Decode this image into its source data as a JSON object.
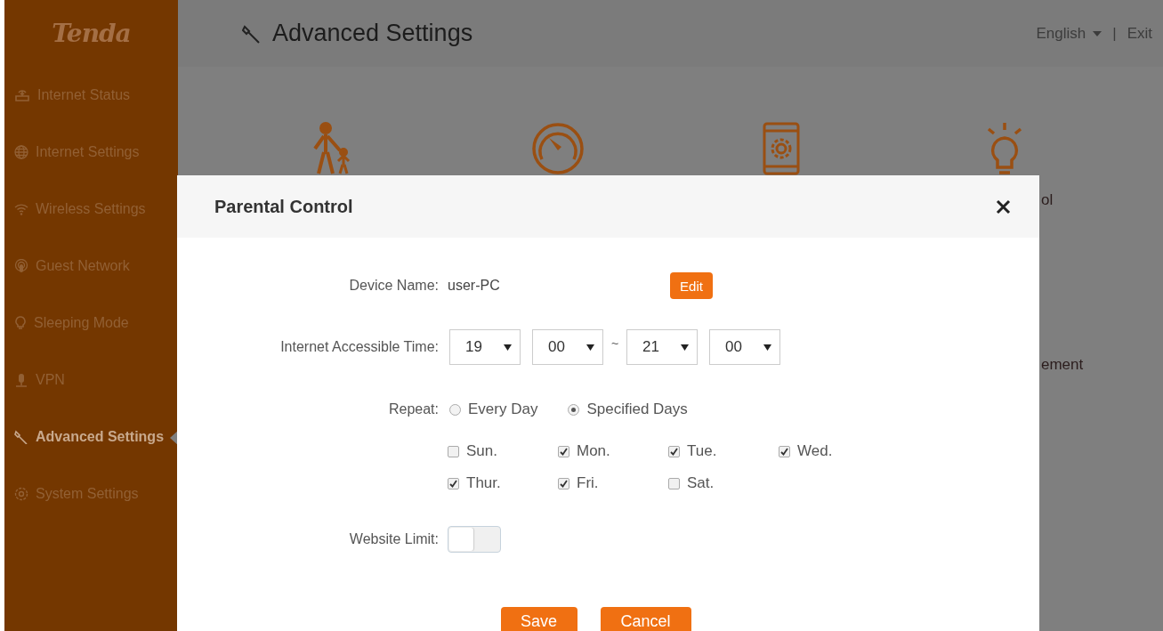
{
  "brand": {
    "logo": "Tenda"
  },
  "sidebar": {
    "items": [
      {
        "label": "Internet Status",
        "selected": false
      },
      {
        "label": "Internet Settings",
        "selected": false
      },
      {
        "label": "Wireless Settings",
        "selected": false
      },
      {
        "label": "Guest Network",
        "selected": false
      },
      {
        "label": "Sleeping Mode",
        "selected": false
      },
      {
        "label": "VPN",
        "selected": false
      },
      {
        "label": "Advanced Settings",
        "selected": true
      },
      {
        "label": "System Settings",
        "selected": false
      }
    ]
  },
  "header": {
    "title": "Advanced Settings",
    "language": "English",
    "separator": "|",
    "exit": "Exit"
  },
  "background_labels": [
    "ol",
    "ement"
  ],
  "dialog": {
    "title": "Parental Control",
    "device_name": {
      "label": "Device Name:",
      "value": "user-PC",
      "button": "Edit"
    },
    "time": {
      "label": "Internet Accessible Time:",
      "separator": "~",
      "selects": [
        "19",
        "00",
        "21",
        "00"
      ]
    },
    "repeat": {
      "label": "Repeat:",
      "options": [
        {
          "label": "Every Day",
          "selected": false
        },
        {
          "label": "Specified Days",
          "selected": true
        }
      ]
    },
    "days": [
      {
        "label": "Sun.",
        "checked": false
      },
      {
        "label": "Mon.",
        "checked": true
      },
      {
        "label": "Tue.",
        "checked": true
      },
      {
        "label": "Wed.",
        "checked": true
      },
      {
        "label": "Thur.",
        "checked": true
      },
      {
        "label": "Fri.",
        "checked": true
      },
      {
        "label": "Sat.",
        "checked": false
      }
    ],
    "website_limit": {
      "label": "Website Limit:",
      "on": false
    },
    "buttons": [
      "Save",
      "Cancel"
    ]
  }
}
